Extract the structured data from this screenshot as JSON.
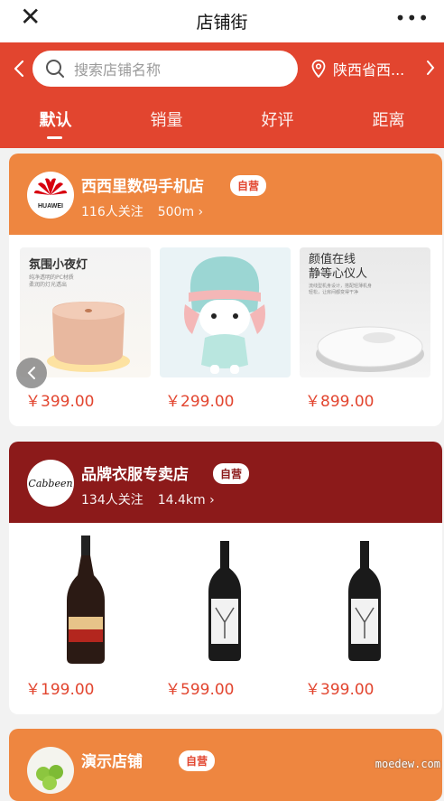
{
  "topbar": {
    "title": "店铺街",
    "close_icon": "close-icon",
    "more_icon": "more-icon"
  },
  "search": {
    "placeholder": "搜索店铺名称",
    "location": "陕西省西..."
  },
  "tabs": [
    "默认",
    "销量",
    "好评",
    "距离"
  ],
  "colors": {
    "brand_red": "#e2452f",
    "card1_header": "#ee8640",
    "card2_header": "#8c1a1a"
  },
  "shops": [
    {
      "name": "西西里数码手机店",
      "badge": "自营",
      "followers": "116人关注",
      "distance": "500m",
      "logo_text": "HUAWEI",
      "products": [
        {
          "label_title": "氛围小夜灯",
          "label_sub": "纯净透明的PC材质\n柔润的灯光透出",
          "price": "￥399.00"
        },
        {
          "price": "￥299.00"
        },
        {
          "label_title": "颜值在线\n静等心仪人",
          "label_sub": "流线型机身设计，搭配轻薄机身\n轻松，让房间都变得干净",
          "price": "￥899.00"
        }
      ]
    },
    {
      "name": "品牌衣服专卖店",
      "badge": "自营",
      "followers": "134人关注",
      "distance": "14.4km",
      "logo_text": "Cabbeen",
      "products": [
        {
          "price": "￥199.00"
        },
        {
          "price": "￥599.00"
        },
        {
          "price": "￥399.00"
        }
      ]
    },
    {
      "name": "演示店铺",
      "badge": "自营"
    }
  ],
  "watermark": "moedew.com"
}
